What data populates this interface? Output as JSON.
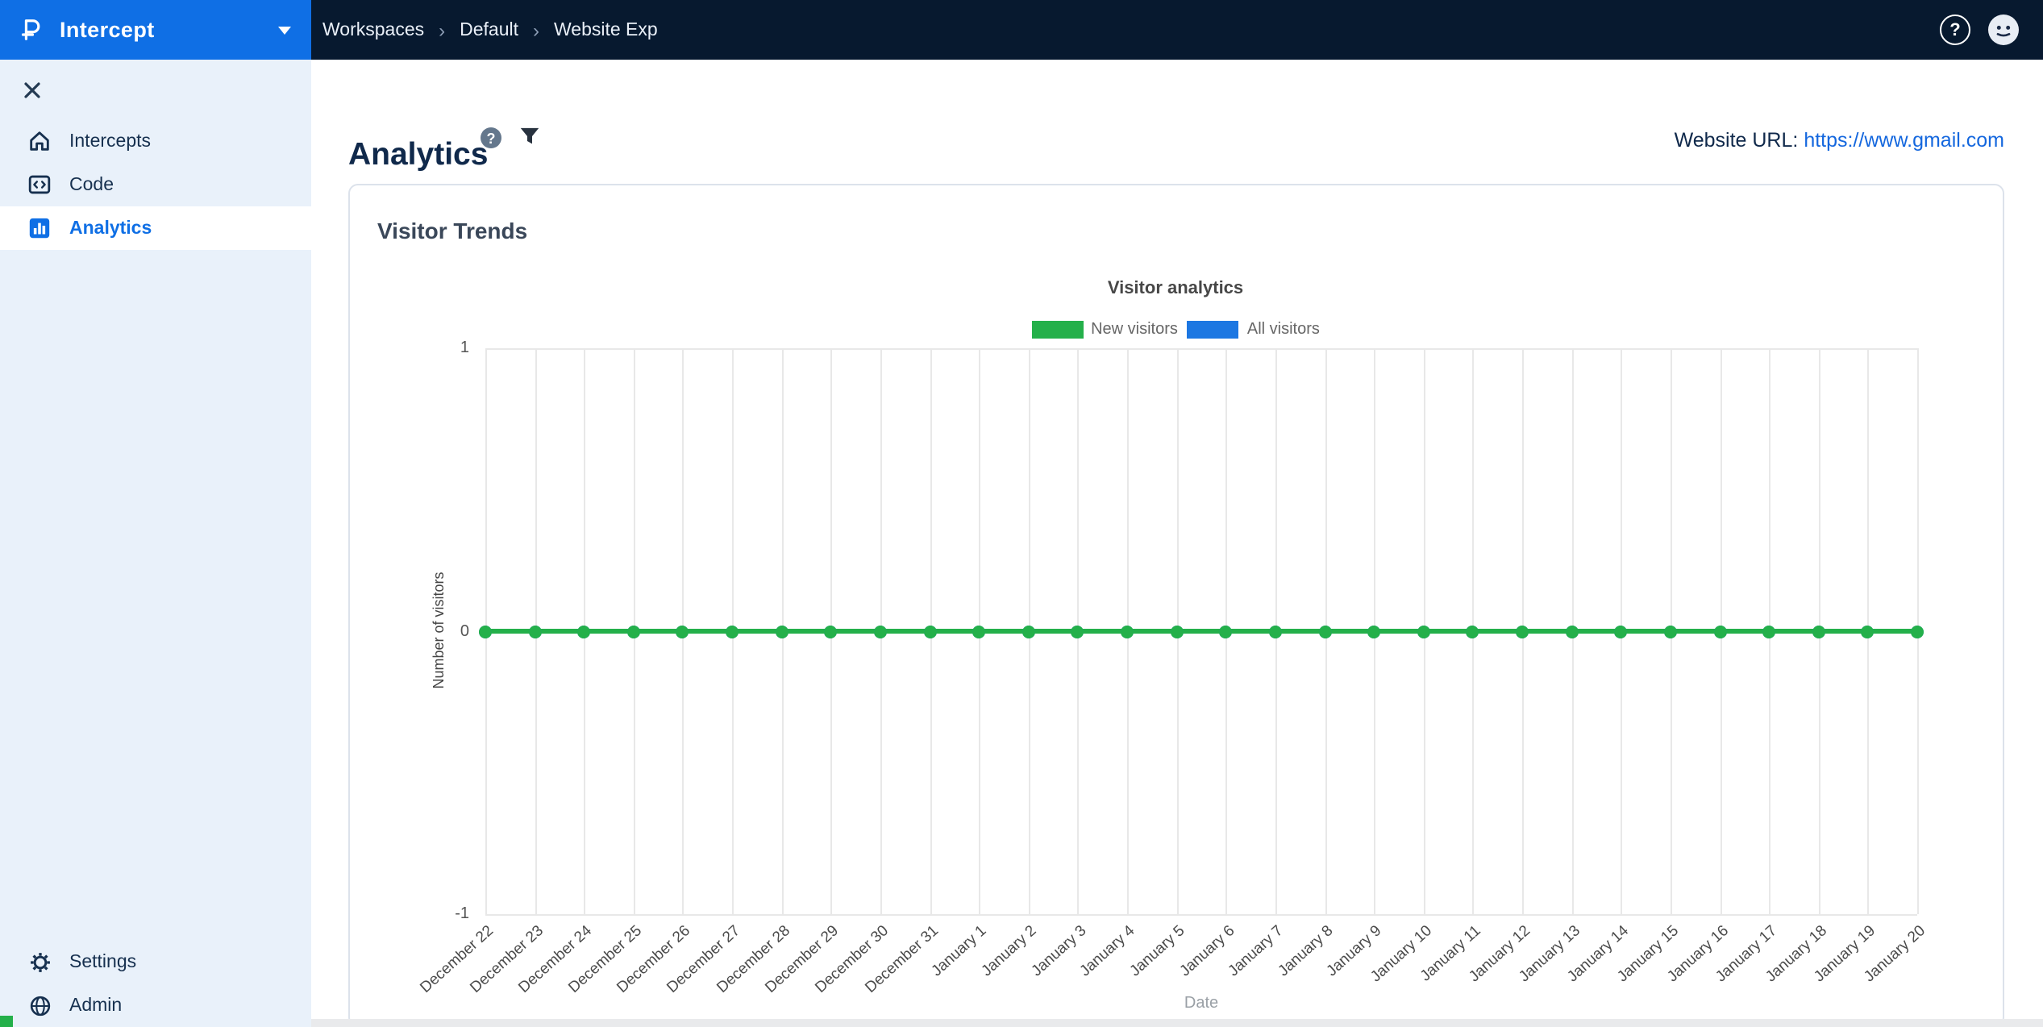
{
  "brand": {
    "name": "Intercept"
  },
  "topbar": {
    "breadcrumb": [
      "Workspaces",
      "Default",
      "Website Exp"
    ],
    "separator": "›",
    "help_glyph": "?"
  },
  "sidebar": {
    "items": [
      {
        "label": "Intercepts",
        "icon": "home-icon"
      },
      {
        "label": "Code",
        "icon": "code-icon"
      },
      {
        "label": "Analytics",
        "icon": "bar-chart-icon",
        "active": true
      }
    ],
    "footer": [
      {
        "label": "Settings",
        "icon": "gear-icon"
      },
      {
        "label": "Admin",
        "icon": "globe-icon"
      }
    ]
  },
  "page": {
    "title": "Analytics",
    "url_label": "Website URL:",
    "url": "https://www.gmail.com"
  },
  "card": {
    "title": "Visitor Trends"
  },
  "chart_data": {
    "type": "line",
    "title": "Visitor analytics",
    "xlabel": "Date",
    "ylabel": "Number of visitors",
    "ylim": [
      -1,
      1
    ],
    "yticks": [
      1,
      0,
      -1
    ],
    "grid": true,
    "legend_position": "top",
    "categories": [
      "December 22",
      "December 23",
      "December 24",
      "December 25",
      "December 26",
      "December 27",
      "December 28",
      "December 29",
      "December 30",
      "December 31",
      "January 1",
      "January 2",
      "January 3",
      "January 4",
      "January 5",
      "January 6",
      "January 7",
      "January 8",
      "January 9",
      "January 10",
      "January 11",
      "January 12",
      "January 13",
      "January 14",
      "January 15",
      "January 16",
      "January 17",
      "January 18",
      "January 19",
      "January 20"
    ],
    "series": [
      {
        "name": "New visitors",
        "color": "#24B04A",
        "values": [
          0,
          0,
          0,
          0,
          0,
          0,
          0,
          0,
          0,
          0,
          0,
          0,
          0,
          0,
          0,
          0,
          0,
          0,
          0,
          0,
          0,
          0,
          0,
          0,
          0,
          0,
          0,
          0,
          0,
          0
        ]
      },
      {
        "name": "All visitors",
        "color": "#1C77E2",
        "values": [
          0,
          0,
          0,
          0,
          0,
          0,
          0,
          0,
          0,
          0,
          0,
          0,
          0,
          0,
          0,
          0,
          0,
          0,
          0,
          0,
          0,
          0,
          0,
          0,
          0,
          0,
          0,
          0,
          0,
          0
        ]
      }
    ]
  }
}
